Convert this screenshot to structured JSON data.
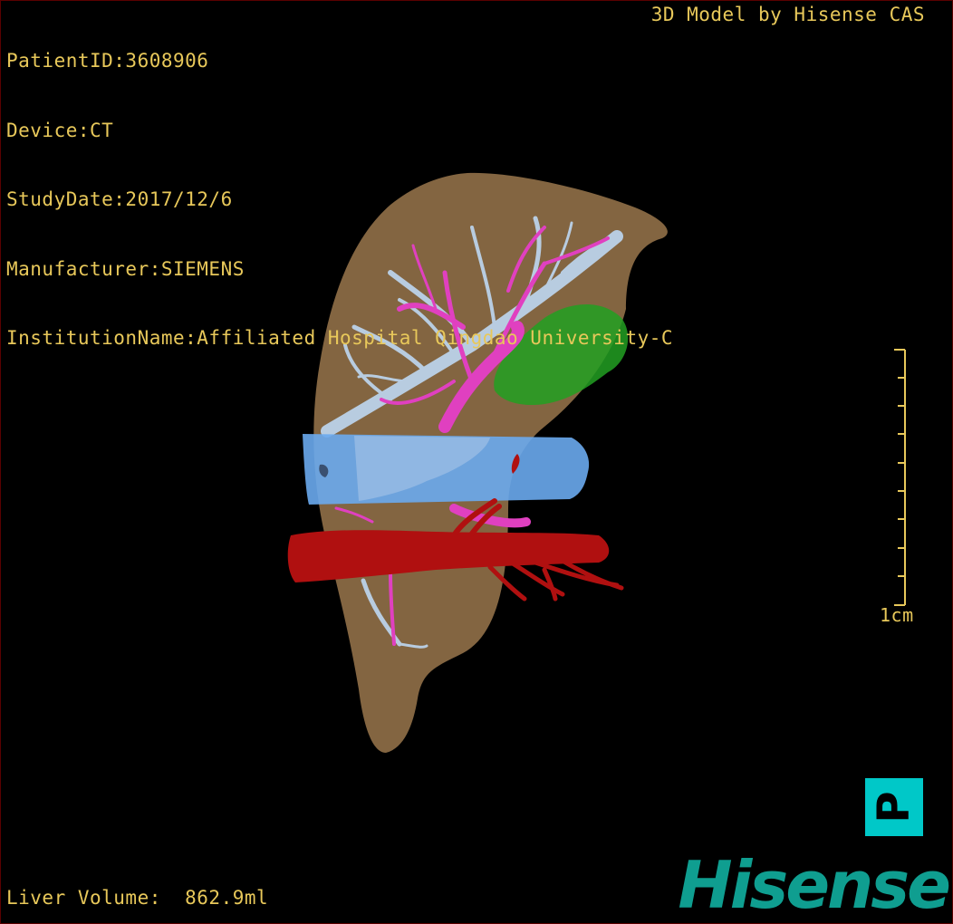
{
  "header_left": {
    "patient_id": "PatientID:3608906",
    "device": "Device:CT",
    "study_date": "StudyDate:2017/12/6",
    "manufacturer": "Manufacturer:SIEMENS",
    "institution": "InstitutionName:Affiliated Hospital Qingdao University-C"
  },
  "header_right": {
    "credit": "3D Model by Hisense CAS"
  },
  "footer": {
    "liver_volume": "Liver Volume:  862.9ml"
  },
  "scale": {
    "label": "1cm"
  },
  "orientation": {
    "marker": "P"
  },
  "brand": {
    "logo_text": "Hisense"
  },
  "colors": {
    "text": "#e8c85a",
    "liver": "#8a6a45",
    "hepatic_vein": "#b8cce0",
    "portal_vein": "#e040c0",
    "vena_cava": "#6aaaee",
    "aorta": "#b01010",
    "gallbladder": "#22a022",
    "orientation_cube": "#00c8c8",
    "brand": "#0f9e90"
  }
}
